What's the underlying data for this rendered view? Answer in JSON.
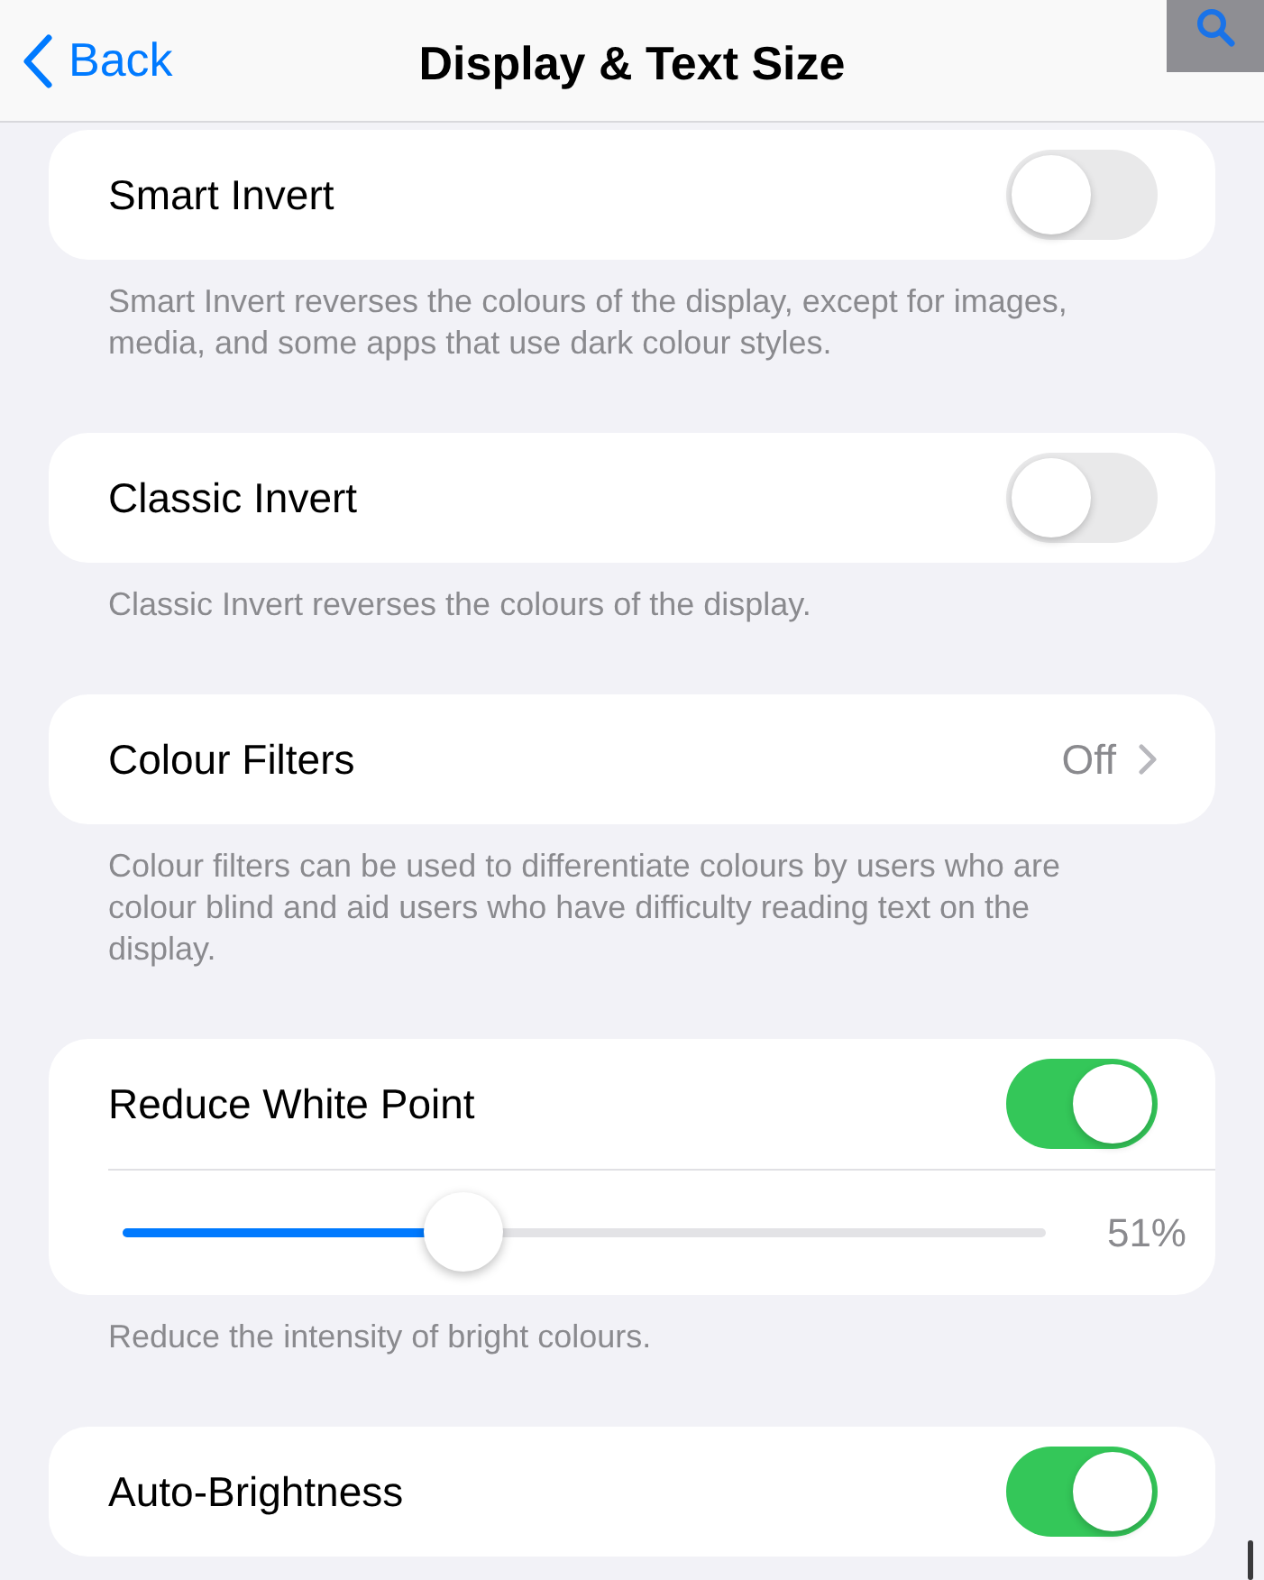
{
  "nav": {
    "back": "Back",
    "title": "Display & Text Size"
  },
  "sections": [
    {
      "kind": "toggle",
      "label": "Smart Invert",
      "on": false,
      "description": "Smart Invert reverses the colours of the display, except for images, media, and some apps that use dark colour styles."
    },
    {
      "kind": "toggle",
      "label": "Classic Invert",
      "on": false,
      "description": "Classic Invert reverses the colours of the display."
    },
    {
      "kind": "link",
      "label": "Colour Filters",
      "value": "Off",
      "description": "Colour filters can be used to differentiate colours by users who are colour blind and aid users who have difficulty reading text on the display."
    },
    {
      "kind": "toggle_slider",
      "label": "Reduce White Point",
      "on": true,
      "slider": {
        "level": 0.37,
        "reading": "51%"
      },
      "description": "Reduce the intensity of bright colours."
    },
    {
      "kind": "toggle",
      "label": "Auto-Brightness",
      "on": true
    }
  ]
}
